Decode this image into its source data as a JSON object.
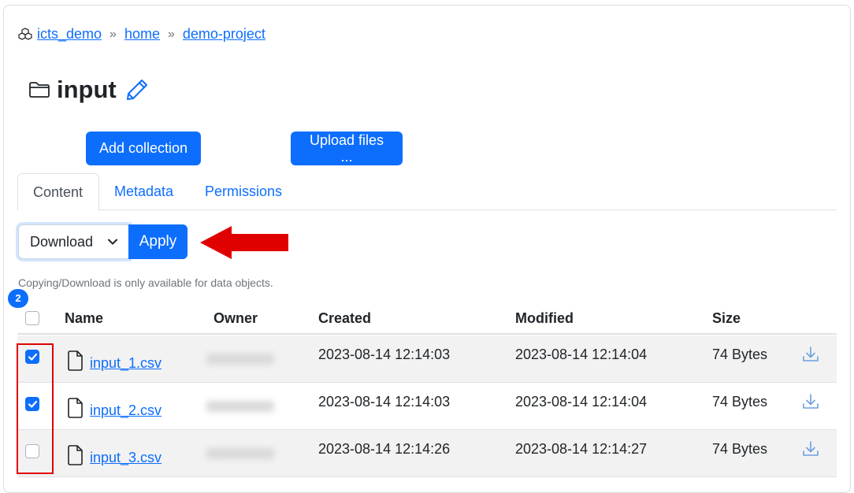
{
  "breadcrumb": {
    "zone_icon": "cubes-icon",
    "items": [
      "icts_demo",
      "home",
      "demo-project"
    ],
    "separator": "»"
  },
  "title": {
    "icon": "folder-icon",
    "text": "input",
    "edit_icon": "pencil-icon"
  },
  "buttons": {
    "add_collection": "Add collection",
    "upload_files": "Upload files ..."
  },
  "tabs": [
    {
      "label": "Content",
      "active": true
    },
    {
      "label": "Metadata",
      "active": false
    },
    {
      "label": "Permissions",
      "active": false
    }
  ],
  "action": {
    "selected": "Download",
    "apply_label": "Apply",
    "note": "Copying/Download is only available for data objects."
  },
  "selection_badge": "2",
  "table": {
    "headers": {
      "name": "Name",
      "owner": "Owner",
      "created": "Created",
      "modified": "Modified",
      "size": "Size"
    },
    "rows": [
      {
        "checked": true,
        "name": "input_1.csv",
        "created": "2023-08-14 12:14:03",
        "modified": "2023-08-14 12:14:04",
        "size": "74 Bytes"
      },
      {
        "checked": true,
        "name": "input_2.csv",
        "created": "2023-08-14 12:14:03",
        "modified": "2023-08-14 12:14:04",
        "size": "74 Bytes"
      },
      {
        "checked": false,
        "name": "input_3.csv",
        "created": "2023-08-14 12:14:26",
        "modified": "2023-08-14 12:14:27",
        "size": "74 Bytes"
      }
    ]
  },
  "colors": {
    "primary": "#0d6efd",
    "annotation_red": "#e00000",
    "stripe": "#f2f2f2"
  }
}
